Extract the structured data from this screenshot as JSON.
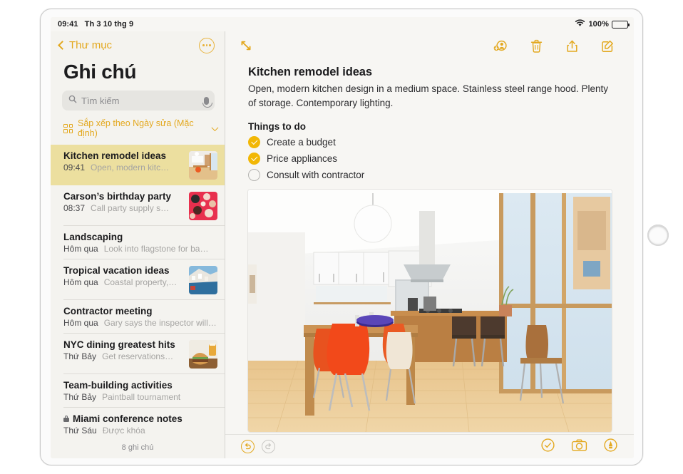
{
  "status_bar": {
    "time": "09:41",
    "date": "Th 3 10 thg 9",
    "wifi_icon": "wifi-icon",
    "battery_percent": "100%",
    "battery_icon": "battery-icon"
  },
  "sidebar": {
    "back_label": "Thư mục",
    "back_icon": "chevron-left-icon",
    "more_icon": "more-options-icon",
    "title": "Ghi chú",
    "search": {
      "placeholder": "Tìm kiếm",
      "value": "",
      "search_icon": "search-icon",
      "mic_icon": "microphone-icon"
    },
    "sort": {
      "label": "Sắp xếp theo Ngày sửa (Mặc định)",
      "grid_icon": "grid-icon",
      "chevron_icon": "chevron-down-icon"
    },
    "notes": [
      {
        "title": "Kitchen remodel ideas",
        "time": "09:41",
        "snippet": "Open, modern kitc…",
        "selected": true,
        "locked": false,
        "thumb": "kitchen"
      },
      {
        "title": "Carson’s birthday party",
        "time": "08:37",
        "snippet": "Call party supply s…",
        "selected": false,
        "locked": false,
        "thumb": "cupcakes"
      },
      {
        "title": "Landscaping",
        "time": "Hôm qua",
        "snippet": "Look into flagstone for ba…",
        "selected": false,
        "locked": false,
        "thumb": null
      },
      {
        "title": "Tropical vacation ideas",
        "time": "Hôm qua",
        "snippet": "Coastal property,…",
        "selected": false,
        "locked": false,
        "thumb": "coast"
      },
      {
        "title": "Contractor meeting",
        "time": "Hôm qua",
        "snippet": "Gary says the inspector will…",
        "selected": false,
        "locked": false,
        "thumb": null
      },
      {
        "title": "NYC dining greatest hits",
        "time": "Thứ Bảy",
        "snippet": "Get reservations…",
        "selected": false,
        "locked": false,
        "thumb": "burger"
      },
      {
        "title": "Team-building activities",
        "time": "Thứ Bảy",
        "snippet": "Paintball tournament",
        "selected": false,
        "locked": false,
        "thumb": null
      },
      {
        "title": "Miami conference notes",
        "time": "Thứ Sáu",
        "snippet": "Được khóa",
        "selected": false,
        "locked": true,
        "thumb": null
      }
    ],
    "footer_count": "8 ghi chú"
  },
  "detail": {
    "toolbar": {
      "expand_icon": "expand-arrows-icon",
      "add_people_icon": "add-person-icon",
      "delete_icon": "trash-icon",
      "share_icon": "share-icon",
      "compose_icon": "compose-icon"
    },
    "note": {
      "title": "Kitchen remodel ideas",
      "paragraph": "Open, modern kitchen design in a medium space. Stainless steel range hood. Plenty of storage. Contemporary lighting.",
      "todo_heading": "Things to do",
      "todos": [
        {
          "label": "Create a budget",
          "checked": true
        },
        {
          "label": "Price appliances",
          "checked": true
        },
        {
          "label": "Consult with contractor",
          "checked": false
        }
      ],
      "photo_alt": "modern kitchen and dining room with orange chairs"
    },
    "footer": {
      "undo_icon": "undo-icon",
      "redo_icon": "redo-icon",
      "checklist_icon": "checklist-circle-icon",
      "camera_icon": "camera-icon",
      "markup_icon": "markup-pen-icon"
    }
  },
  "colors": {
    "accent": "#e3a81e",
    "check_fill": "#f2b705",
    "selected_row": "#ecdf9f",
    "sidebar_bg": "#f4f3ef",
    "detail_bg": "#f7f6f3"
  }
}
